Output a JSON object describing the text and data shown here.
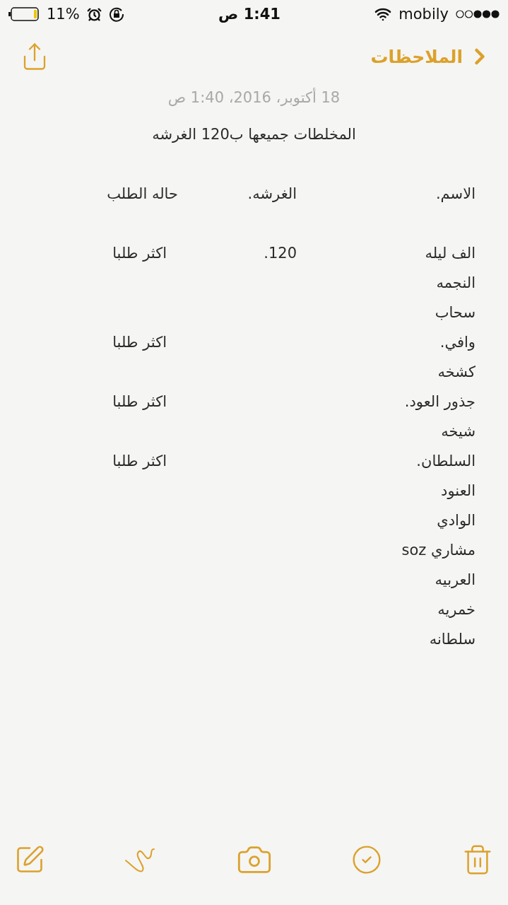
{
  "status_bar": {
    "battery": "11%",
    "time": "1:41 ص",
    "carrier": "mobily"
  },
  "nav": {
    "back_label": "الملاحظات"
  },
  "note": {
    "date": "18 أكتوبر، 2016، 1:40 ص",
    "title": "المخلطات جميعها ب120 الغرشه",
    "columns": [
      "الاسم.",
      "الغرشه.",
      "حاله الطلب"
    ],
    "rows": [
      {
        "name": "الف ليله",
        "price": "120.",
        "status": "اكثر طلبا"
      },
      {
        "name": "النجمه"
      },
      {
        "name": "سحاب"
      },
      {
        "name": "وافي.",
        "status": "اكثر طلبا"
      },
      {
        "name": "كشخه"
      },
      {
        "name": "جذور العود.",
        "status": "اكثر طلبا"
      },
      {
        "name": "شيخه"
      },
      {
        "name": "السلطان.",
        "status": "اكثر طلبا"
      },
      {
        "name": "العنود"
      },
      {
        "name": "الوادي"
      },
      {
        "name": "مشاري soz"
      },
      {
        "name": "العربيه"
      },
      {
        "name": "خمريه"
      },
      {
        "name": "سلطانه"
      }
    ]
  }
}
